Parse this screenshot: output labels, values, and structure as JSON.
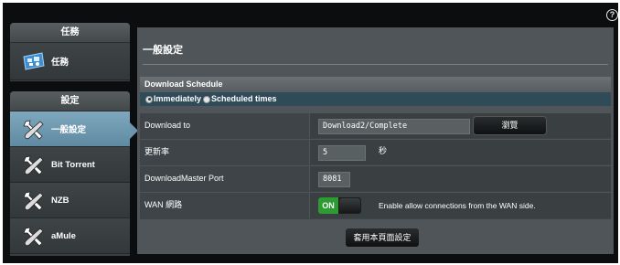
{
  "help": {
    "glyph": "?"
  },
  "sidebar": {
    "tasks_panel": {
      "header": "任務",
      "items": [
        {
          "label": "任務",
          "icon": "task-icon"
        }
      ]
    },
    "settings_panel": {
      "header": "設定",
      "items": [
        {
          "label": "一般設定",
          "icon": "tools-icon",
          "active": true
        },
        {
          "label": "Bit Torrent",
          "icon": "tools-icon",
          "active": false
        },
        {
          "label": "NZB",
          "icon": "tools-icon",
          "active": false
        },
        {
          "label": "aMule",
          "icon": "tools-icon",
          "active": false
        }
      ]
    }
  },
  "main": {
    "title": "一般設定",
    "schedule": {
      "header": "Download Schedule",
      "options": [
        {
          "label": "Immediately",
          "checked": true
        },
        {
          "label": "Scheduled times",
          "checked": false
        }
      ]
    },
    "download_to": {
      "label": "Download to",
      "value": "Download2/Complete",
      "browse_label": "瀏覽"
    },
    "refresh_rate": {
      "label": "更新率",
      "value": "5",
      "unit": "秒"
    },
    "port": {
      "label": "DownloadMaster Port",
      "value": "8081"
    },
    "wan": {
      "label": "WAN 網路",
      "toggle_label": "ON",
      "toggle_on": true,
      "description": "Enable allow connections from the WAN side."
    },
    "apply_label": "套用本頁面設定"
  },
  "colors": {
    "background": "#0b0d0e",
    "panel": "#4f5558",
    "active_item": "#6b95ab",
    "toggle_on": "#2e9a32",
    "radio_row": "#2f4b58"
  }
}
